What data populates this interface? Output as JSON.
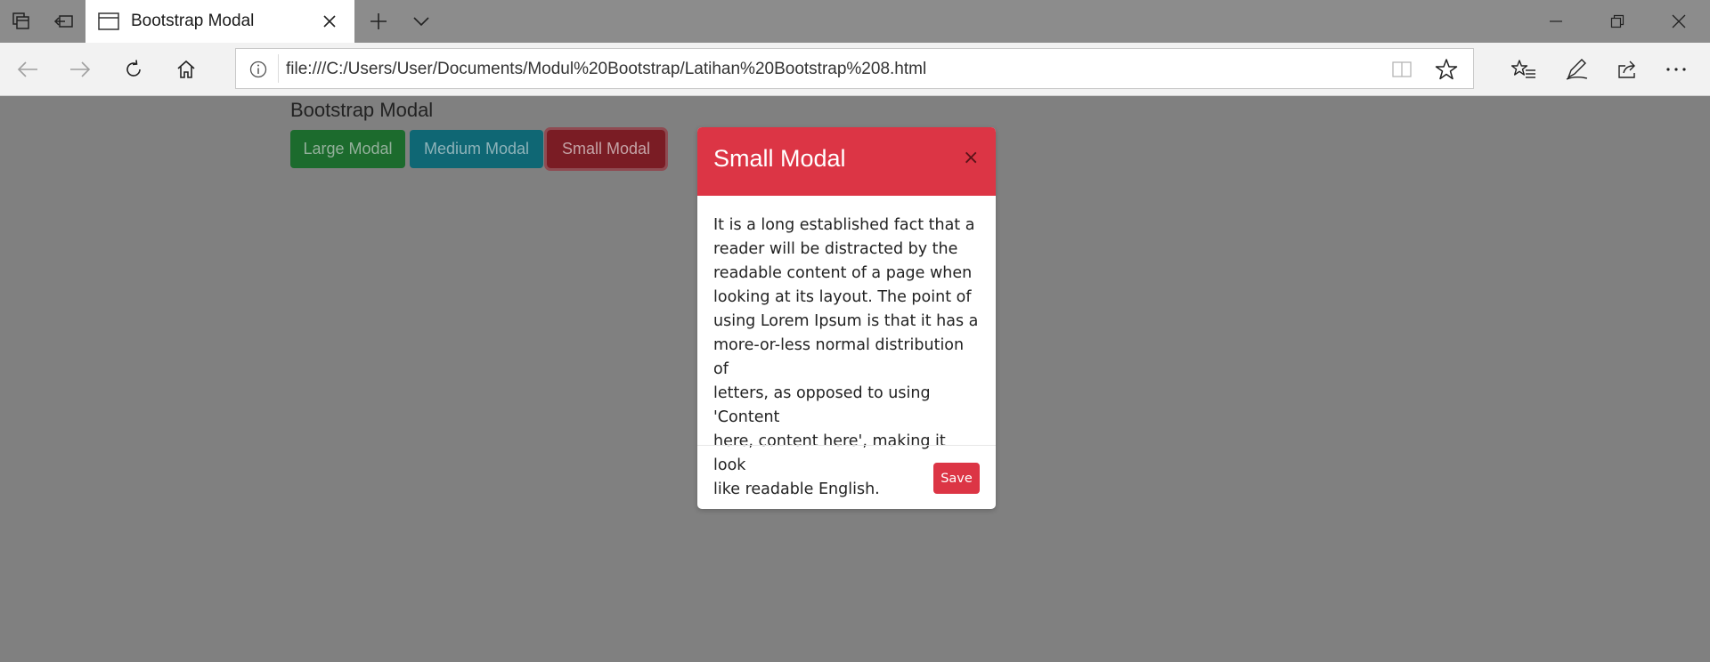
{
  "browser": {
    "tab_title": "Bootstrap Modal",
    "address_url": "file:///C:/Users/User/Documents/Modul%20Bootstrap/Latihan%20Bootstrap%208.html"
  },
  "page": {
    "title": "Bootstrap Modal",
    "buttons": {
      "large": "Large Modal",
      "medium": "Medium Modal",
      "small": "Small Modal"
    }
  },
  "modal": {
    "title": "Small Modal",
    "close_glyph": "×",
    "body_lines": [
      "It is a long established fact that a",
      "reader will be distracted by the",
      "readable content of a page when",
      "looking at its layout. The point of",
      "using Lorem Ipsum is that it has a",
      "more-or-less normal distribution of",
      "letters, as opposed to using 'Content",
      "here, content here', making it look",
      "like readable English."
    ],
    "save_label": "Save"
  },
  "colors": {
    "danger": "#dc3545",
    "success_dim": "#1c6b2d",
    "info_dim": "#0f6774",
    "overlay_bg": "#808080"
  },
  "icons": [
    "tab-sets-icon",
    "set-tabs-aside-icon",
    "page-icon",
    "close-icon",
    "new-tab-icon",
    "tab-list-chevron-icon",
    "minimize-icon",
    "restore-icon",
    "window-close-icon",
    "back-icon",
    "forward-icon",
    "refresh-icon",
    "home-icon",
    "info-icon",
    "reading-view-icon",
    "favorite-star-icon",
    "favorites-icon",
    "pen-icon",
    "share-icon",
    "more-icon"
  ]
}
